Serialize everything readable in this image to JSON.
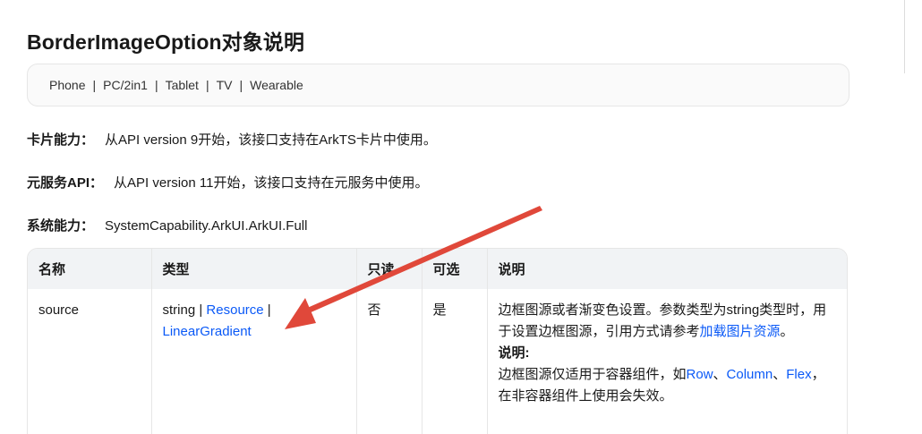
{
  "title": "BorderImageOption对象说明",
  "devices": [
    "Phone",
    "PC/2in1",
    "Tablet",
    "TV",
    "Wearable"
  ],
  "device_separator": "|",
  "info": {
    "card_label": "卡片能力：",
    "card_text": "从API version 9开始，该接口支持在ArkTS卡片中使用。",
    "atomic_label": "元服务API：",
    "atomic_text": "从API version 11开始，该接口支持在元服务中使用。",
    "syscap_label": "系统能力：",
    "syscap_text": "SystemCapability.ArkUI.ArkUI.Full"
  },
  "table": {
    "headers": [
      "名称",
      "类型",
      "只读",
      "可选",
      "说明"
    ],
    "row": {
      "name": "source",
      "type_prefix": "string | ",
      "type_link1": "Resource",
      "type_sep": " |",
      "type_link2": "LinearGradient",
      "readonly": "否",
      "optional": "是",
      "desc_text1": "边框图源或者渐变色设置。参数类型为string类型时，用于设置边框图源，引用方式请参考",
      "desc_link": "加载图片资源",
      "desc_end": "。",
      "note_title": "说明:",
      "note_text1": "边框图源仅适用于容器组件，如",
      "note_link_row": "Row",
      "note_sep1": "、",
      "note_link_column": "Column",
      "note_sep2": "、",
      "note_link_flex": "Flex",
      "note_text2": "，在非容器组件上使用会失效。"
    }
  },
  "colors": {
    "link": "#0a59f7",
    "arrow": "#e0483a",
    "header_bg": "#f1f3f5"
  }
}
